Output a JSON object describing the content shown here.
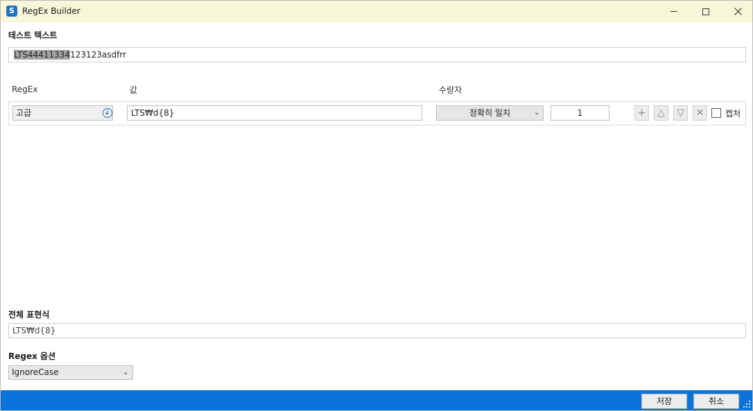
{
  "window": {
    "title": "RegEx Builder",
    "icon_glyph": "S",
    "controls": [
      "minimize-icon",
      "maximize-icon",
      "close-icon"
    ]
  },
  "test_text": {
    "label": "테스트 텍스트",
    "highlighted": "LTS44411334",
    "rest": "123123asdfrr"
  },
  "columns": {
    "regex": "RegEx",
    "value": "값",
    "quantifier": "수량자"
  },
  "row": {
    "type": "고급",
    "value": "LTS₩d{8}",
    "quantifier": "정확히 일치",
    "count": "1",
    "add_glyph": "+",
    "up_glyph": "△",
    "down_glyph": "▽",
    "remove_glyph": "✕",
    "capture_label": "캡처",
    "capture_checked": false
  },
  "full_expression": {
    "label": "전체 표현식",
    "value": "LTS₩d{8}"
  },
  "options": {
    "label": "Regex 옵션",
    "selected": "IgnoreCase"
  },
  "footer": {
    "save": "저장",
    "cancel": "취소"
  },
  "colors": {
    "titlebar": "#f7f6d9",
    "footer": "#0a74da",
    "highlight": "#a5a5a5",
    "info": "#1f6fd1"
  }
}
